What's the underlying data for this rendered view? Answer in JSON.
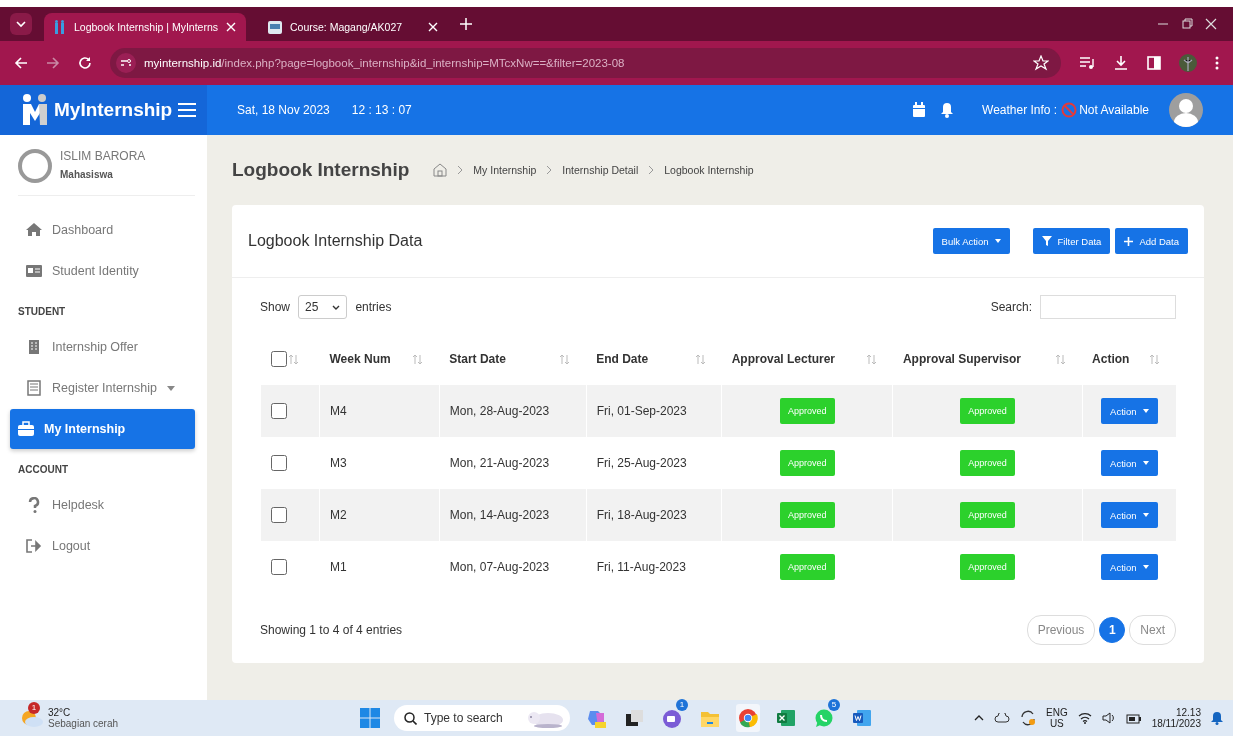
{
  "browser": {
    "tabs": [
      {
        "title": "Logbook Internship | MyInterns",
        "selected": true
      },
      {
        "title": "Course: Magang/AK027",
        "selected": false
      }
    ],
    "url": {
      "host": "myinternship.id",
      "path": "/index.php?page=logbook_internship&id_internship=MTcxNw==&filter=2023-08"
    }
  },
  "header": {
    "logo": "MyInternship",
    "date": "Sat, 18 Nov 2023",
    "time": "12 : 13 : 07",
    "weather_label": "Weather Info :",
    "weather_value": "Not Available"
  },
  "sidebar": {
    "user": {
      "name": "ISLIM BARORA",
      "role": "Mahasiswa"
    },
    "items": [
      {
        "kind": "link",
        "label": "Dashboard",
        "selected": false
      },
      {
        "kind": "link",
        "label": "Student Identity",
        "selected": false
      },
      {
        "kind": "section",
        "label": "STUDENT"
      },
      {
        "kind": "link",
        "label": "Internship Offer",
        "selected": false
      },
      {
        "kind": "dropdown",
        "label": "Register Internship",
        "selected": false
      },
      {
        "kind": "link",
        "label": "My Internship",
        "selected": true
      },
      {
        "kind": "section",
        "label": "ACCOUNT"
      },
      {
        "kind": "link",
        "label": "Helpdesk",
        "selected": false
      },
      {
        "kind": "link",
        "label": "Logout",
        "selected": false
      }
    ]
  },
  "page": {
    "title": "Logbook Internship",
    "breadcrumb": [
      "My Internship",
      "Internship Detail",
      "Logbook Internship"
    ]
  },
  "card": {
    "title": "Logbook Internship Data",
    "buttons": [
      {
        "kind": "dropdown",
        "label": "Bulk Action"
      },
      {
        "kind": "filter",
        "label": "Filter Data"
      },
      {
        "kind": "add",
        "label": "Add Data"
      }
    ],
    "show_label": "Show",
    "page_size": "25",
    "entries_label": "entries",
    "search_label": "Search:",
    "select_all_checked": false,
    "columns": [
      "Week Num",
      "Start Date",
      "End Date",
      "Approval Lecturer",
      "Approval Supervisor",
      "Action"
    ],
    "rows": [
      {
        "checked": false,
        "week": "M4",
        "start": "Mon, 28-Aug-2023",
        "end": "Fri, 01-Sep-2023",
        "lecturer": "Approved",
        "supervisor": "Approved",
        "action": "Action"
      },
      {
        "checked": false,
        "week": "M3",
        "start": "Mon, 21-Aug-2023",
        "end": "Fri, 25-Aug-2023",
        "lecturer": "Approved",
        "supervisor": "Approved",
        "action": "Action"
      },
      {
        "checked": false,
        "week": "M2",
        "start": "Mon, 14-Aug-2023",
        "end": "Fri, 18-Aug-2023",
        "lecturer": "Approved",
        "supervisor": "Approved",
        "action": "Action"
      },
      {
        "checked": false,
        "week": "M1",
        "start": "Mon, 07-Aug-2023",
        "end": "Fri, 11-Aug-2023",
        "lecturer": "Approved",
        "supervisor": "Approved",
        "action": "Action"
      }
    ],
    "info": "Showing 1 to 4 of 4 entries",
    "pagination": [
      {
        "label": "Previous",
        "selected": false,
        "disabled": true
      },
      {
        "label": "1",
        "selected": true,
        "disabled": false
      },
      {
        "label": "Next",
        "selected": false,
        "disabled": true
      }
    ]
  },
  "taskbar": {
    "weather": {
      "badge": "1",
      "temp": "32°C",
      "desc": "Sebagian cerah"
    },
    "search_placeholder": "Type to search",
    "apps": [
      {
        "kind": "copilot"
      },
      {
        "kind": "taskview"
      },
      {
        "kind": "meet",
        "badge": "1"
      },
      {
        "kind": "folder"
      },
      {
        "kind": "chrome",
        "selected": true
      },
      {
        "kind": "excel"
      },
      {
        "kind": "whatsapp",
        "badge": "5"
      },
      {
        "kind": "word"
      }
    ],
    "lang": "ENG",
    "region": "US",
    "clock": "12.13",
    "date": "18/11/2023"
  }
}
